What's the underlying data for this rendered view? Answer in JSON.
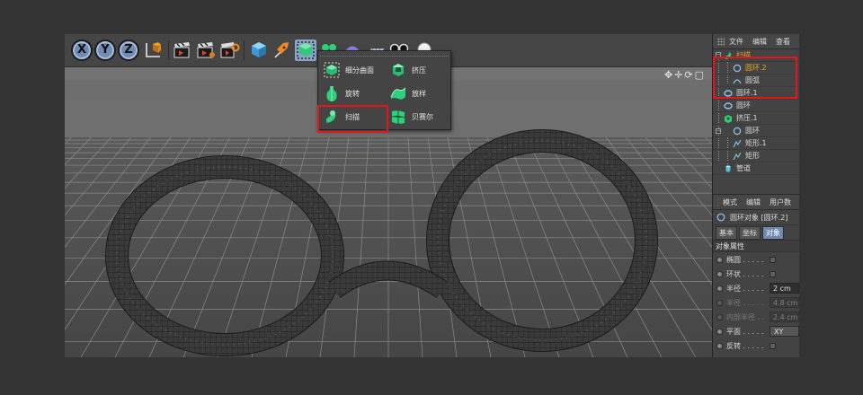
{
  "toolbar": {
    "axis_labels": [
      "X",
      "Y",
      "Z"
    ]
  },
  "viewport": {
    "nav_icons": [
      "move-icon",
      "zoom-icon",
      "rotate-icon",
      "maximize-icon"
    ],
    "nav_glyphs": [
      "✥",
      "✛",
      "⟳",
      "▢"
    ]
  },
  "popup_menu": {
    "items": [
      {
        "label": "细分曲面",
        "icon": "subdivision-surface-icon"
      },
      {
        "label": "挤压",
        "icon": "extrude-icon"
      },
      {
        "label": "旋转",
        "icon": "lathe-icon"
      },
      {
        "label": "放样",
        "icon": "loft-icon"
      },
      {
        "label": "扫描",
        "icon": "sweep-icon",
        "highlighted": true
      },
      {
        "label": "贝赛尔",
        "icon": "bezier-icon"
      }
    ]
  },
  "object_manager": {
    "menu": [
      "文件",
      "编辑",
      "查看"
    ],
    "tree": [
      {
        "label": "扫描",
        "icon": "sweep-icon",
        "level": 0,
        "color": "#e8a520"
      },
      {
        "label": "圆环.2",
        "icon": "circle-spline-icon",
        "level": 1,
        "color": "#e8a520"
      },
      {
        "label": "圆弧",
        "icon": "arc-spline-icon",
        "level": 1
      },
      {
        "label": "圆环.1",
        "icon": "circle-spline-icon",
        "level": 0
      },
      {
        "label": "圆环",
        "icon": "circle-spline-icon",
        "level": 0
      },
      {
        "label": "挤压.1",
        "icon": "extrude-icon",
        "level": 0
      },
      {
        "label": "圆环",
        "icon": "circle-spline-icon",
        "level": 1
      },
      {
        "label": "矩形.1",
        "icon": "rectangle-spline-icon",
        "level": 1
      },
      {
        "label": "矩形",
        "icon": "rectangle-spline-icon",
        "level": 1
      },
      {
        "label": "管道",
        "icon": "tube-icon",
        "level": 0
      }
    ]
  },
  "attributes": {
    "menu": [
      "模式",
      "编辑",
      "用户数"
    ],
    "title": "圆环对象 [圆环.2]",
    "tabs": [
      "基本",
      "坐标",
      "对象"
    ],
    "active_tab": "对象",
    "section": "对象属性",
    "props": [
      {
        "label": "椭圆 . . . . .",
        "type": "checkbox",
        "enabled": true
      },
      {
        "label": "环状 . . . . .",
        "type": "checkbox",
        "enabled": true
      },
      {
        "label": "半径 . . . . .",
        "type": "value",
        "value": "2 cm",
        "enabled": true
      },
      {
        "label": "半径 . . . . .",
        "type": "value",
        "value": "4.8 cm",
        "enabled": false
      },
      {
        "label": "内部半径 . .",
        "type": "value",
        "value": "2.4 cm",
        "enabled": false
      },
      {
        "label": "平面 . . . . .",
        "type": "select",
        "value": "XY",
        "enabled": true
      },
      {
        "label": "反转 . . . . .",
        "type": "checkbox",
        "enabled": true
      }
    ]
  },
  "colors": {
    "highlight_red": "#e4161b",
    "accent_blue": "#6f8ab3",
    "selected_yellow": "#e8a520",
    "primitive_green": "#2fd07b",
    "primitive_cyan": "#4ec3e0"
  }
}
